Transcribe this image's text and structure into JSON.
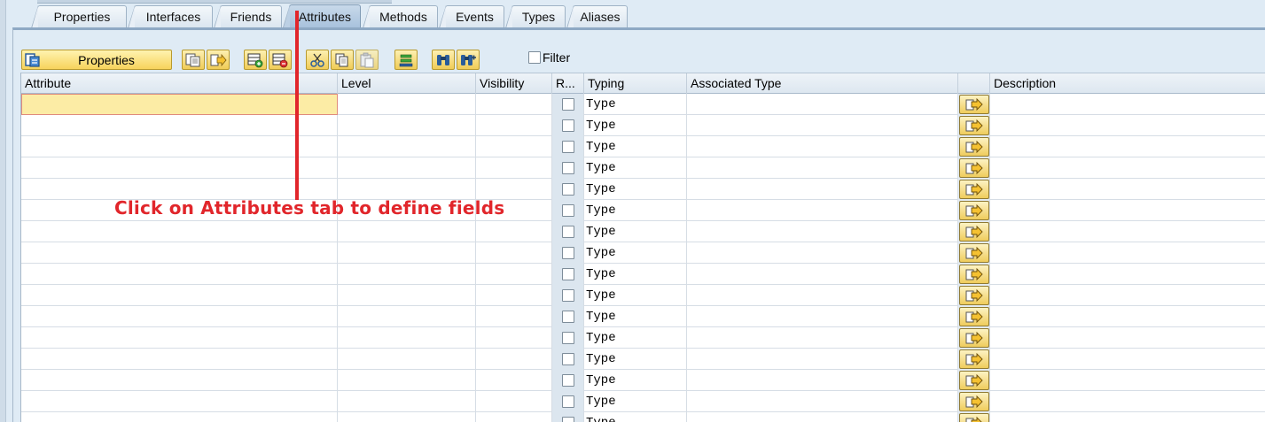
{
  "tabs": [
    {
      "label": "Properties"
    },
    {
      "label": "Interfaces"
    },
    {
      "label": "Friends"
    },
    {
      "label": "Attributes",
      "active": true
    },
    {
      "label": "Methods"
    },
    {
      "label": "Events"
    },
    {
      "label": "Types"
    },
    {
      "label": "Aliases"
    }
  ],
  "toolbar": {
    "properties_label": "Properties",
    "filter_label": "Filter"
  },
  "grid": {
    "columns": [
      "Attribute",
      "Level",
      "Visibility",
      "R...",
      "Typing",
      "Associated Type",
      "",
      "Description"
    ],
    "rows": [
      {
        "attribute": "",
        "typing": "Type"
      },
      {
        "attribute": "",
        "typing": "Type"
      },
      {
        "attribute": "",
        "typing": "Type"
      },
      {
        "attribute": "",
        "typing": "Type"
      },
      {
        "attribute": "",
        "typing": "Type"
      },
      {
        "attribute": "",
        "typing": "Type"
      },
      {
        "attribute": "",
        "typing": "Type"
      },
      {
        "attribute": "",
        "typing": "Type"
      },
      {
        "attribute": "",
        "typing": "Type"
      },
      {
        "attribute": "",
        "typing": "Type"
      },
      {
        "attribute": "",
        "typing": "Type"
      },
      {
        "attribute": "",
        "typing": "Type"
      },
      {
        "attribute": "",
        "typing": "Type"
      },
      {
        "attribute": "",
        "typing": "Type"
      },
      {
        "attribute": "",
        "typing": "Type"
      },
      {
        "attribute": "",
        "typing": "Type"
      }
    ]
  },
  "annotation": {
    "text": "Click on Attributes tab to define fields",
    "color": "#e1262b"
  },
  "colors": {
    "background": "#dfebf5",
    "button_yellow": "#f7d35c",
    "selected_cell": "#fceca5"
  }
}
